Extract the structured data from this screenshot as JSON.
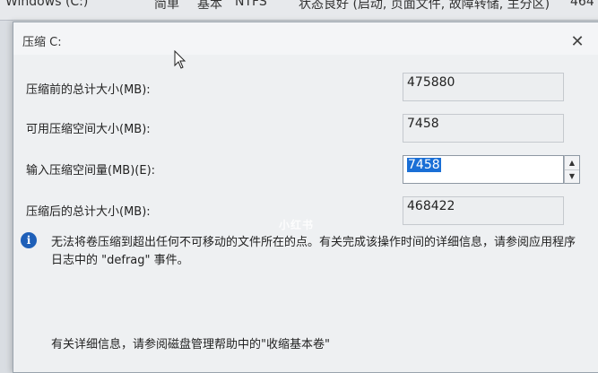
{
  "background_row": {
    "name": "Windows (C:)",
    "layout": "简单",
    "type": "基本",
    "filesystem": "NTFS",
    "status": "状态良好 (启动, 页面文件, 故障转储, 主分区)",
    "capacity": "464"
  },
  "dialog": {
    "title": "压缩 C:",
    "close_icon": "close-icon",
    "fields": {
      "total_before_label": "压缩前的总计大小(MB):",
      "total_before_value": "475880",
      "available_label": "可用压缩空间大小(MB):",
      "available_value": "7458",
      "input_label": "输入压缩空间量(MB)(E):",
      "input_value": "7458",
      "total_after_label": "压缩后的总计大小(MB):",
      "total_after_value": "468422"
    },
    "info_icon": "info-icon",
    "info_text": "无法将卷压缩到超出任何不可移动的文件所在的点。有关完成该操作时间的详细信息，请参阅应用程序日志中的 \"defrag\" 事件。",
    "footer_text": "有关详细信息，请参阅磁盘管理帮助中的\"收缩基本卷\""
  },
  "watermark": "小红书"
}
